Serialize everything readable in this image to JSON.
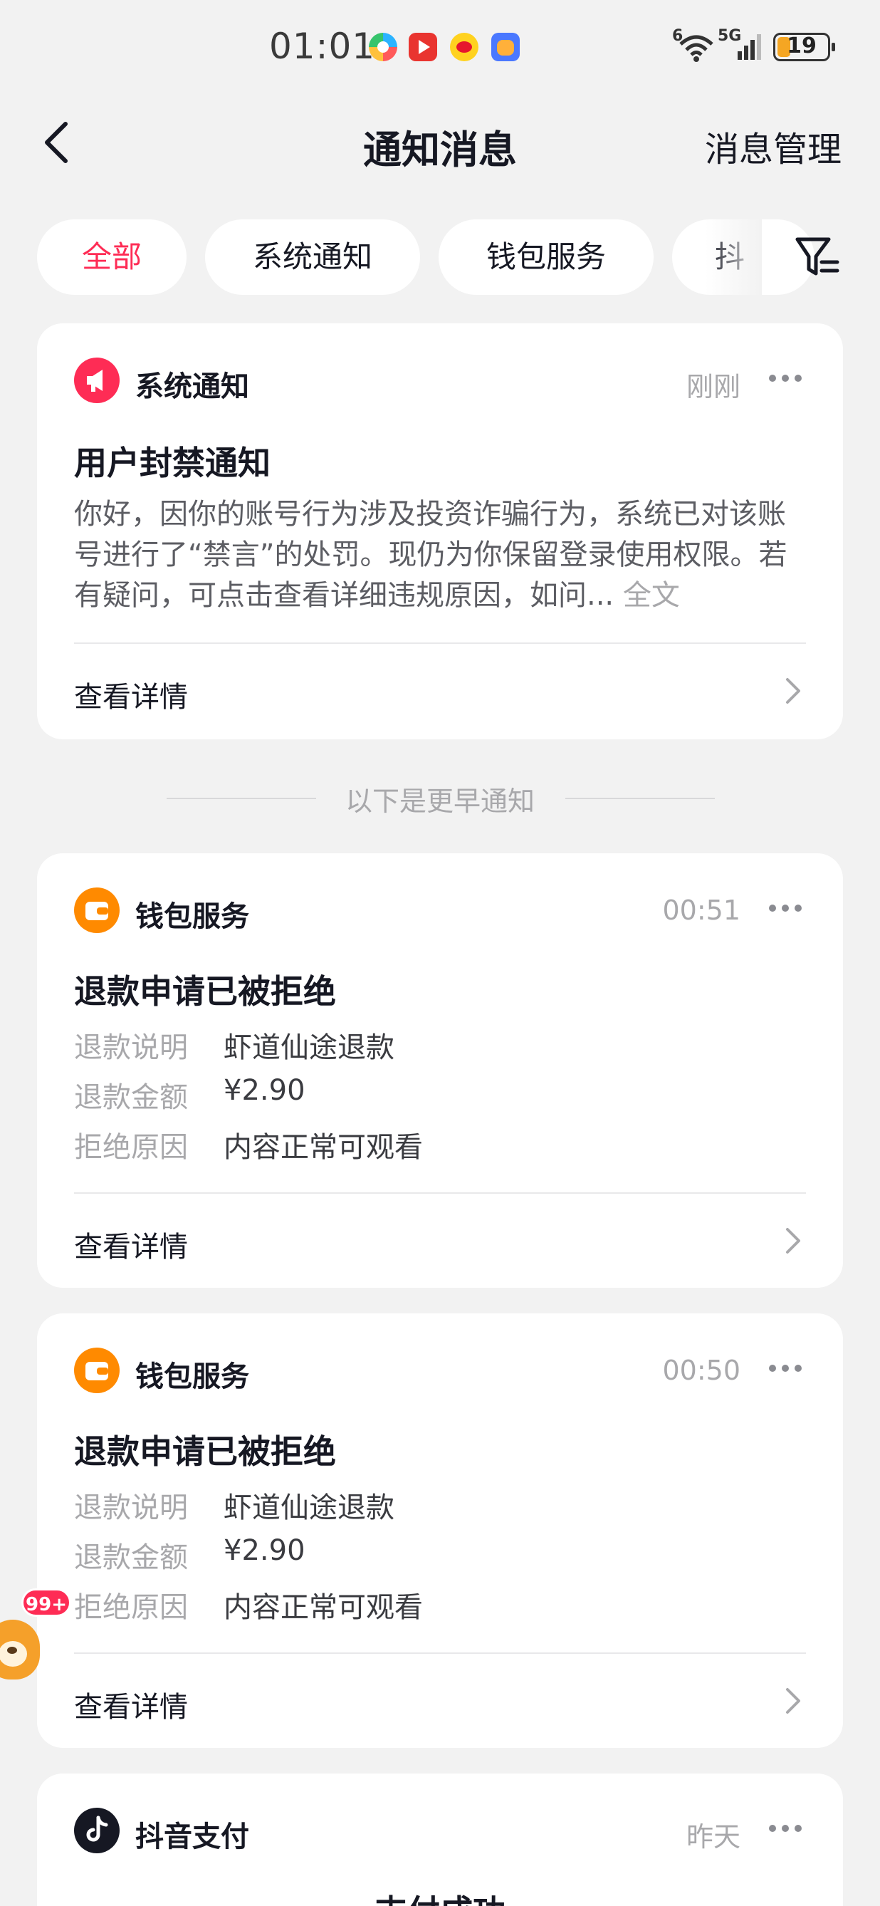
{
  "status_bar": {
    "time": "01:01",
    "wifi_label": "6",
    "cell_label": "5G",
    "battery": "19"
  },
  "header": {
    "title": "通知消息",
    "manage": "消息管理"
  },
  "tabs": [
    "全部",
    "系统通知",
    "钱包服务",
    "抖"
  ],
  "cards": [
    {
      "source": "系统通知",
      "time": "刚刚",
      "title": "用户封禁通知",
      "body": "你好，因你的账号行为涉及投资诈骗行为，系统已对该账号进行了“禁言”的处罚。现仍为你保留登录使用权限。若有疑问，可点击查看详细违规原因，如问...",
      "fulltext": "全文",
      "detail": "查看详情"
    },
    {
      "source": "钱包服务",
      "time": "00:51",
      "title": "退款申请已被拒绝",
      "rows": [
        {
          "k": "退款说明",
          "v": "虾道仙途退款"
        },
        {
          "k": "退款金额",
          "v": "¥2.90"
        },
        {
          "k": "拒绝原因",
          "v": "内容正常可观看"
        }
      ],
      "detail": "查看详情"
    },
    {
      "source": "钱包服务",
      "time": "00:50",
      "title": "退款申请已被拒绝",
      "rows": [
        {
          "k": "退款说明",
          "v": "虾道仙途退款"
        },
        {
          "k": "退款金额",
          "v": "¥2.90"
        },
        {
          "k": "拒绝原因",
          "v": "内容正常可观看"
        }
      ],
      "detail": "查看详情"
    },
    {
      "source": "抖音支付",
      "time": "昨天",
      "title": "支付成功"
    }
  ],
  "separator": "以下是更早通知",
  "pet_badge": "99+",
  "colors": {
    "accent": "#fe2c55",
    "wallet": "#ff8a00",
    "system": "#fe2c55",
    "douyin": "#161823"
  },
  "icons": {
    "system": "megaphone-icon",
    "wallet": "wallet-icon",
    "douyin": "douyin-logo-icon"
  }
}
